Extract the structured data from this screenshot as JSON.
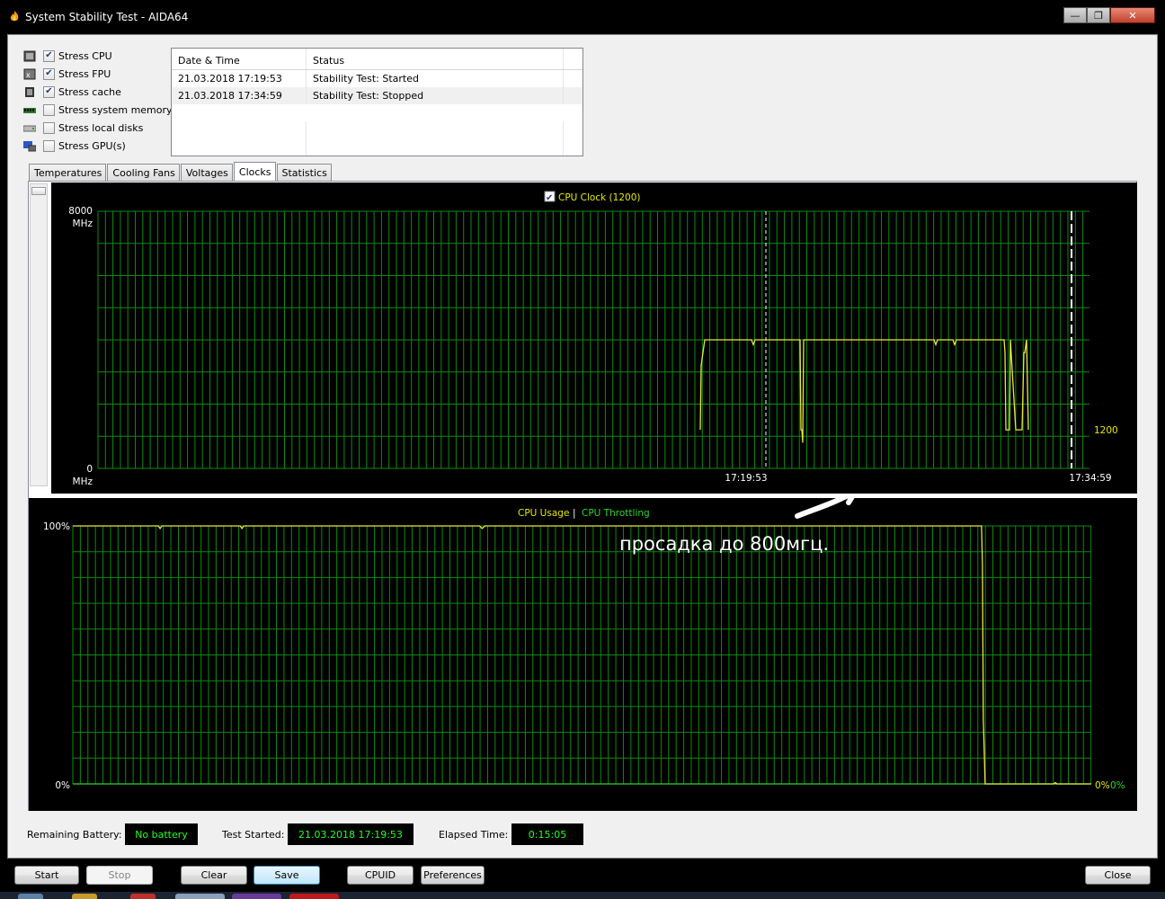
{
  "window": {
    "title": "System Stability Test - AIDA64",
    "controls": {
      "minimize": "—",
      "maximize": "❐",
      "close": "✕"
    }
  },
  "stress_options": [
    {
      "label": "Stress CPU",
      "checked": true,
      "icon": "cpu-icon"
    },
    {
      "label": "Stress FPU",
      "checked": true,
      "icon": "fpu-icon"
    },
    {
      "label": "Stress cache",
      "checked": true,
      "icon": "cache-icon"
    },
    {
      "label": "Stress system memory",
      "checked": false,
      "icon": "memory-icon"
    },
    {
      "label": "Stress local disks",
      "checked": false,
      "icon": "disk-icon"
    },
    {
      "label": "Stress GPU(s)",
      "checked": false,
      "icon": "gpu-icon"
    }
  ],
  "log": {
    "columns": [
      "Date & Time",
      "Status"
    ],
    "rows": [
      [
        "21.03.2018 17:19:53",
        "Stability Test: Started"
      ],
      [
        "21.03.2018 17:34:59",
        "Stability Test: Stopped"
      ]
    ]
  },
  "tabs": [
    "Temperatures",
    "Cooling Fans",
    "Voltages",
    "Clocks",
    "Statistics"
  ],
  "active_tab": "Clocks",
  "colors": {
    "chart_bg": "#000000",
    "grid": "#0f8a0f",
    "trace": "#e8e83c",
    "legend_yellow": "#e8e800",
    "legend_green": "#2cd62c",
    "status_text": "#22ff22"
  },
  "annotation": "просадка до 800мгц.",
  "chart_data": [
    {
      "type": "line",
      "legend_checked": true,
      "title": "CPU Clock (1200)",
      "ylabel_top": "8000",
      "ylabel_bottom": "0",
      "yunit": "MHz",
      "ylim": [
        0,
        8000
      ],
      "current_value_label": "1200",
      "grid": true,
      "markers": [
        "17:19:53",
        "17:34:59"
      ],
      "series": [
        {
          "name": "CPU Clock",
          "x": [
            0,
            670,
            671,
            675,
            676,
            727,
            729,
            731,
            780,
            781,
            782,
            783,
            784,
            785,
            786,
            930,
            932,
            934,
            951,
            953,
            955,
            1008,
            1009,
            1010,
            1012,
            1014,
            1015,
            1021,
            1022,
            1024,
            1025,
            1028,
            1030,
            1031,
            1033,
            1035
          ],
          "y": [
            null,
            1200,
            3200,
            4000,
            4000,
            4000,
            3850,
            4000,
            4000,
            4000,
            1200,
            1200,
            800,
            4000,
            4000,
            4000,
            3850,
            4000,
            4000,
            3850,
            4000,
            4000,
            3600,
            1200,
            1200,
            1200,
            4000,
            1200,
            1200,
            1200,
            1200,
            1200,
            3600,
            3600,
            4000,
            1200
          ]
        }
      ]
    },
    {
      "type": "line",
      "legend": [
        "CPU Usage",
        "CPU Throttling"
      ],
      "ylabel_top": "100%",
      "ylabel_bottom": "0%",
      "ylim": [
        0,
        100
      ],
      "right_value_labels": [
        "0%",
        "0%"
      ],
      "grid": true,
      "series": [
        {
          "name": "CPU Usage",
          "x": [
            0,
            95,
            97,
            99,
            186,
            188,
            190,
            452,
            455,
            458,
            1010,
            1011,
            1012,
            1014,
            1015,
            1090,
            1092,
            1094,
            1132
          ],
          "y": [
            100,
            100,
            99,
            100,
            100,
            99,
            100,
            100,
            99,
            100,
            100,
            85,
            25,
            0,
            0,
            0,
            0.5,
            0,
            0
          ]
        },
        {
          "name": "CPU Throttling",
          "x": [
            0,
            1132
          ],
          "y": [
            0,
            0
          ]
        }
      ]
    }
  ],
  "status": {
    "battery_label": "Remaining Battery:",
    "battery_value": "No battery",
    "started_label": "Test Started:",
    "started_value": "21.03.2018 17:19:53",
    "elapsed_label": "Elapsed Time:",
    "elapsed_value": "0:15:05"
  },
  "buttons": {
    "start": "Start",
    "stop": "Stop",
    "clear": "Clear",
    "save": "Save",
    "cpuid": "CPUID",
    "preferences": "Preferences",
    "close": "Close"
  }
}
